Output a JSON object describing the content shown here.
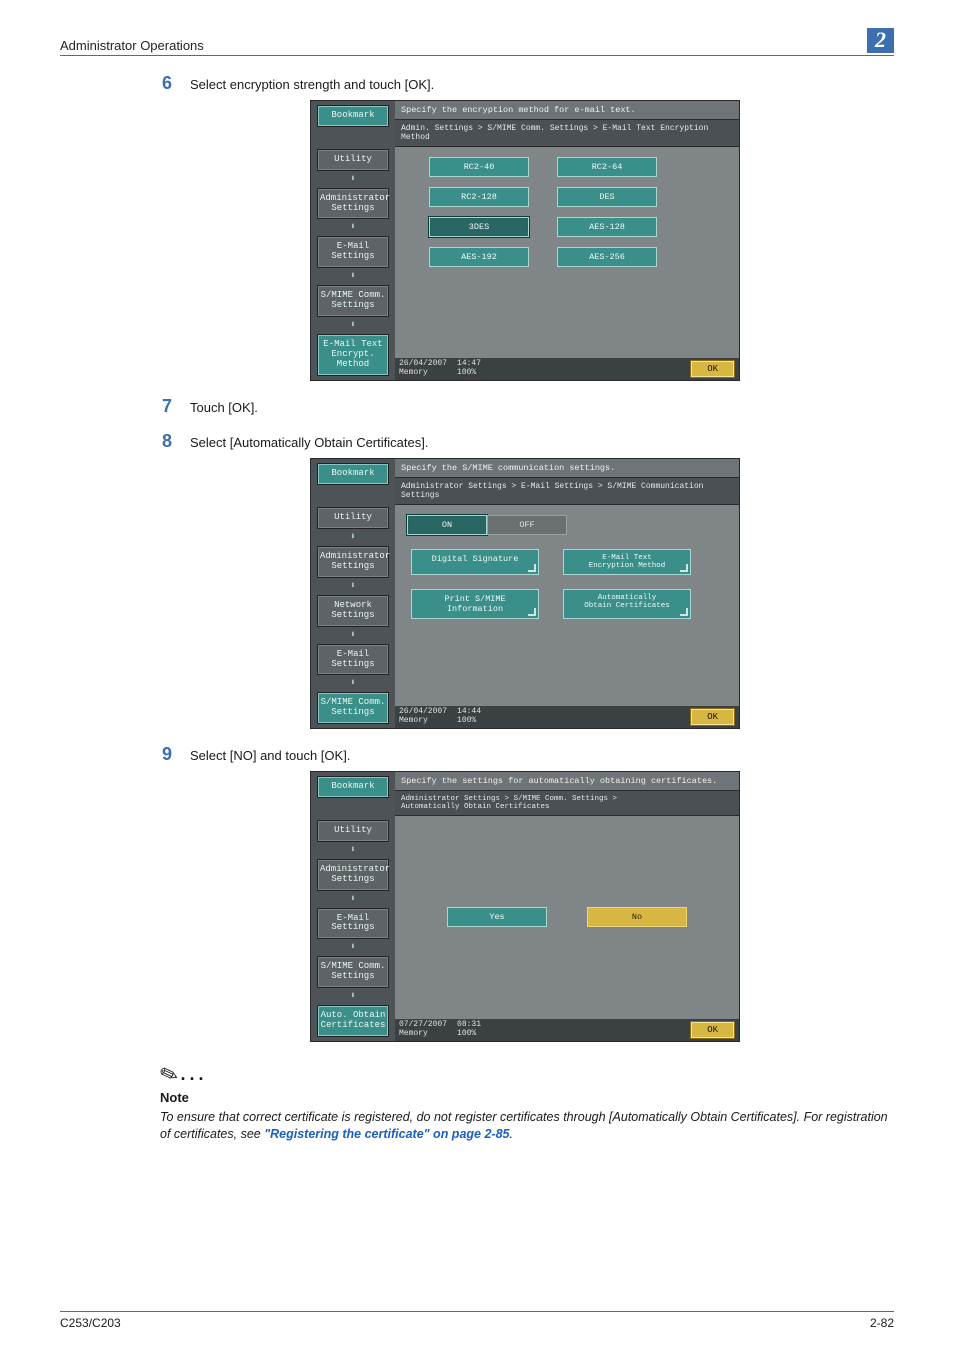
{
  "header": {
    "title": "Administrator Operations",
    "chapter_badge": "2"
  },
  "footer": {
    "model": "C253/C203",
    "page_ref": "2-82"
  },
  "steps": {
    "s6": {
      "num": "6",
      "text": "Select encryption strength and touch [OK]."
    },
    "s7": {
      "num": "7",
      "text": "Touch [OK]."
    },
    "s8": {
      "num": "8",
      "text": "Select [Automatically Obtain Certificates]."
    },
    "s9": {
      "num": "9",
      "text": "Select [NO] and touch [OK]."
    }
  },
  "panel1": {
    "prompt": "Specify the encryption method for e-mail text.",
    "breadcrumb": "Admin. Settings > S/MIME Comm. Settings > E-Mail Text Encryption Method",
    "side": {
      "bookmark": "Bookmark",
      "utility": "Utility",
      "admin": "Administrator\nSettings",
      "email": "E-Mail\nSettings",
      "smime": "S/MIME Comm.\nSettings",
      "current": "E-Mail Text\nEncrypt. Method"
    },
    "options": {
      "rc2_40": "RC2-40",
      "rc2_64": "RC2-64",
      "rc2_128": "RC2-128",
      "des": "DES",
      "tdes": "3DES",
      "aes_128": "AES-128",
      "aes_192": "AES-192",
      "aes_256": "AES-256"
    },
    "status": {
      "date": "26/04/2007",
      "time": "14:47",
      "mem_label": "Memory",
      "mem_val": "100%",
      "ok": "OK"
    }
  },
  "panel2": {
    "prompt": "Specify the S/MIME communication settings.",
    "breadcrumb": "Administrator Settings > E-Mail Settings > S/MIME Communication Settings",
    "side": {
      "bookmark": "Bookmark",
      "utility": "Utility",
      "admin": "Administrator\nSettings",
      "network": "Network\nSettings",
      "email": "E-Mail\nSettings",
      "current": "S/MIME Comm.\nSettings"
    },
    "toggle": {
      "on": "ON",
      "off": "OFF"
    },
    "options": {
      "digital_sig": "Digital Signature",
      "enc_method": "E-Mail Text\nEncryption Method",
      "print_info": "Print S/MIME Information",
      "auto_cert": "Automatically\nObtain Certificates"
    },
    "status": {
      "date": "26/04/2007",
      "time": "14:44",
      "mem_label": "Memory",
      "mem_val": "100%",
      "ok": "OK"
    }
  },
  "panel3": {
    "prompt": "Specify the settings for automatically obtaining certificates.",
    "breadcrumb": "Administrator Settings > S/MIME Comm. Settings >\nAutomatically Obtain Certificates",
    "side": {
      "bookmark": "Bookmark",
      "utility": "Utility",
      "admin": "Administrator\nSettings",
      "email": "E-Mail\nSettings",
      "smime": "S/MIME Comm.\nSettings",
      "current": "Auto. Obtain\nCertificates"
    },
    "options": {
      "yes": "Yes",
      "no": "No"
    },
    "status": {
      "date": "07/27/2007",
      "time": "08:31",
      "mem_label": "Memory",
      "mem_val": "100%",
      "ok": "OK"
    }
  },
  "note": {
    "label": "Note",
    "body_a": "To ensure that correct certificate is registered, do not register certificates through [Automatically Obtain Certificates]. For registration of certificates, see ",
    "link": "\"Registering the certificate\" on page 2-85",
    "body_b": "."
  }
}
